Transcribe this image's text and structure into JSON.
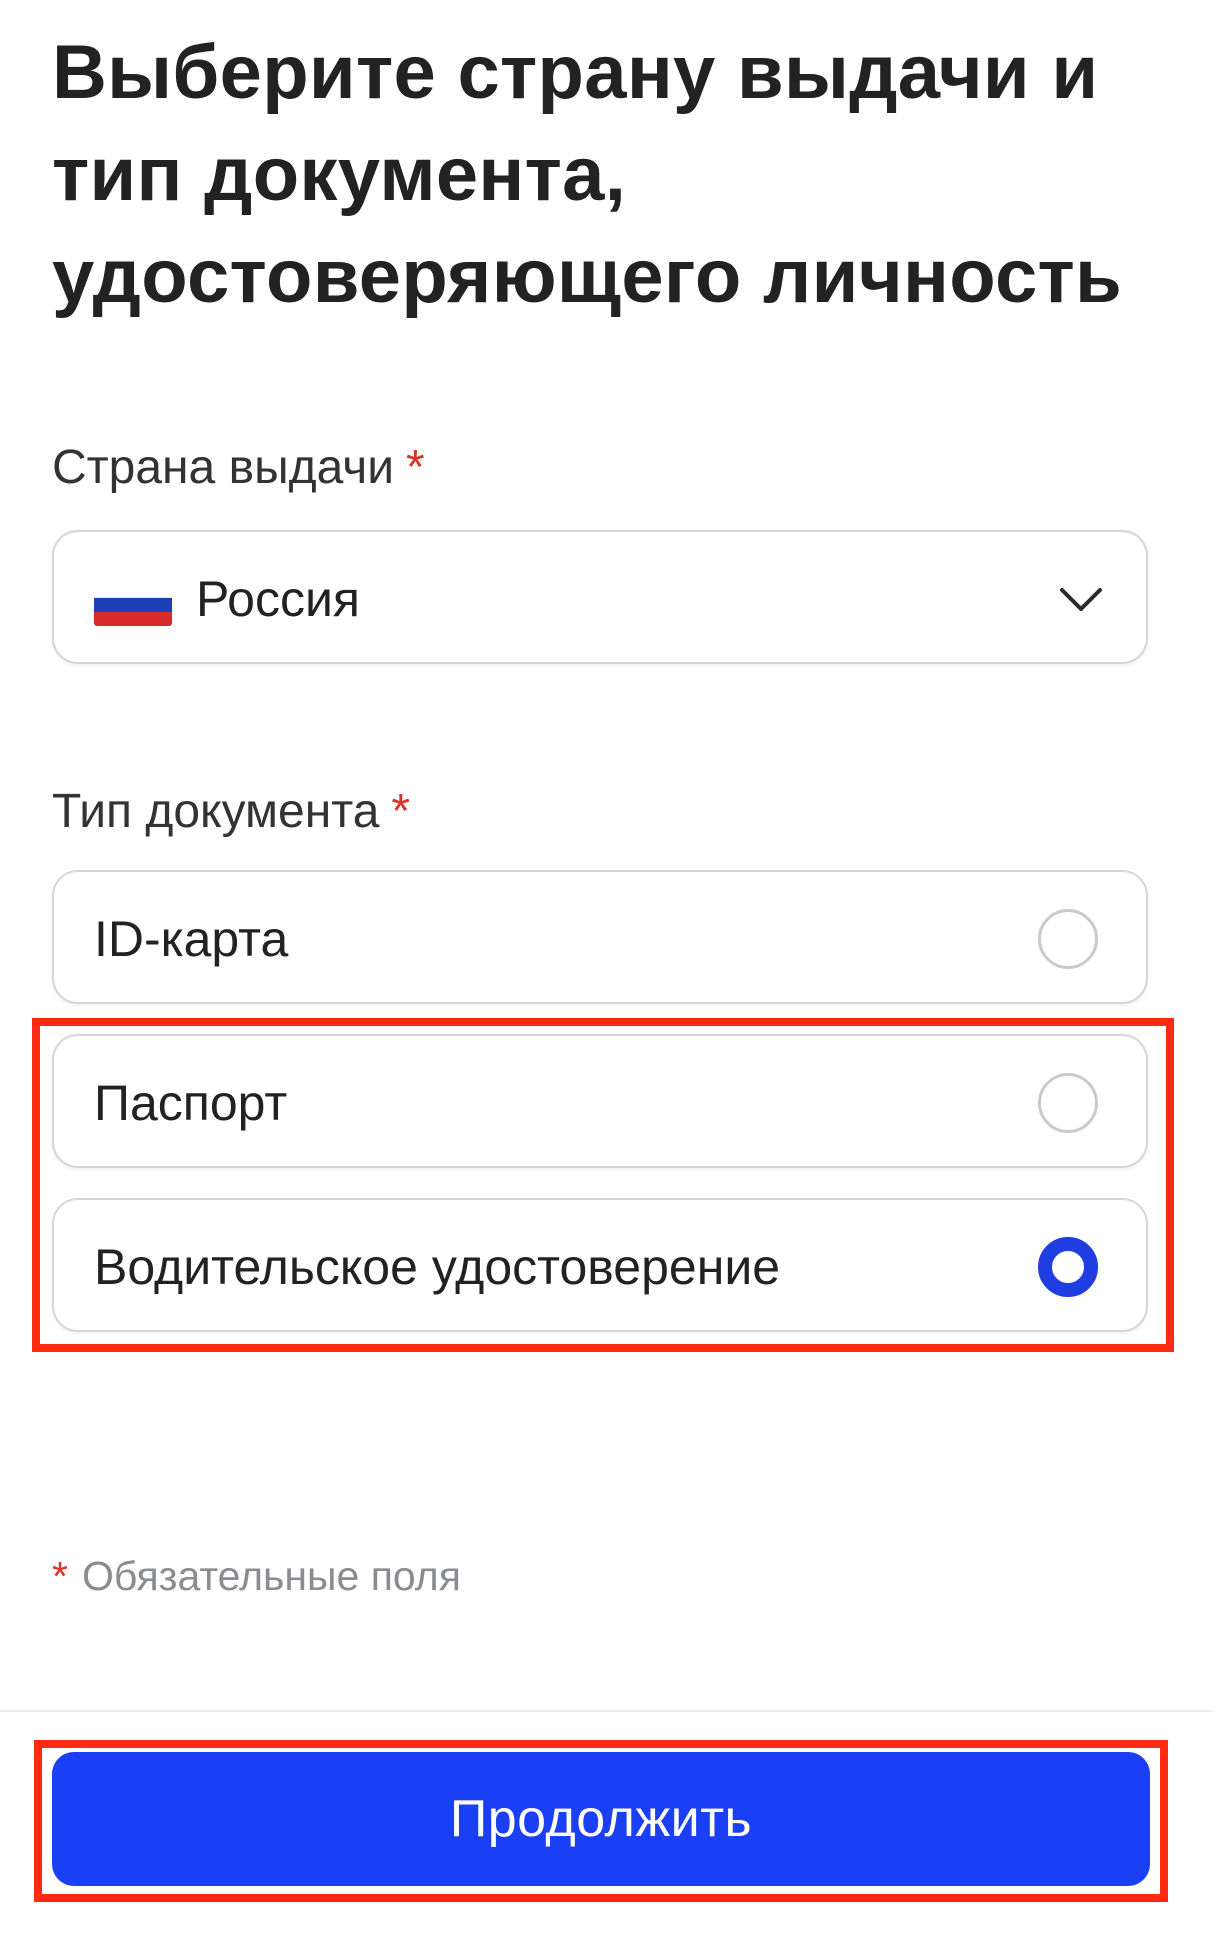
{
  "page": {
    "title": "Выберите страну выдачи и тип документа, удостоверяющего личность"
  },
  "country": {
    "label": "Страна выдачи",
    "required_mark": "*",
    "selected_value": "Россия",
    "flag_colors": [
      "#ffffff",
      "#1d3fb8",
      "#d52b2b"
    ]
  },
  "document_type": {
    "label": "Тип документа",
    "required_mark": "*",
    "options": [
      {
        "label": "ID-карта",
        "selected": false
      },
      {
        "label": "Паспорт",
        "selected": false
      },
      {
        "label": "Водительское удостоверение",
        "selected": true
      }
    ]
  },
  "footer": {
    "required_mark": "*",
    "note": "Обязательные поля"
  },
  "actions": {
    "continue_label": "Продолжить"
  },
  "colors": {
    "accent": "#1a3ff5",
    "required": "#d9342b",
    "highlight": "#ff2a12"
  }
}
